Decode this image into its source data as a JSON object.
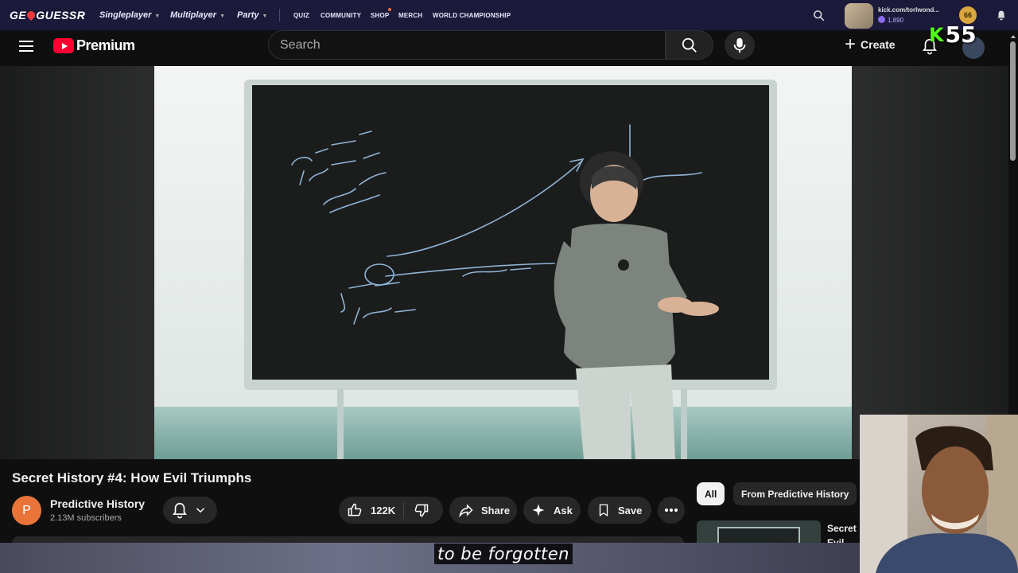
{
  "geo": {
    "logo": "GEOGUESSR",
    "nav": [
      "Singleplayer",
      "Multiplayer",
      "Party"
    ],
    "nav_small": [
      "QUIZ",
      "COMMUNITY",
      "SHOP",
      "MERCH",
      "WORLD CHAMPIONSHIP"
    ],
    "user": "kick.com/torlwond...",
    "coins": "1,890",
    "level": "66"
  },
  "youtube": {
    "logo": "Premium",
    "search_placeholder": "Search",
    "create": "Create"
  },
  "kick": {
    "letter": "K",
    "count": "55"
  },
  "video": {
    "title": "Secret History #4: How Evil Triumphs",
    "channel": "Predictive History",
    "channel_initial": "P",
    "subscribers": "2.13M subscribers",
    "likes": "122K",
    "share": "Share",
    "ask": "Ask",
    "save": "Save"
  },
  "chips": [
    "All",
    "From Predictive History"
  ],
  "recommended": {
    "title": "Secret Evil"
  },
  "subtitle": "to be forgotten",
  "colors": {
    "youtube_red": "#ff0033",
    "kick_green": "#53fc18",
    "geo_bar": "#1c1a3a"
  }
}
